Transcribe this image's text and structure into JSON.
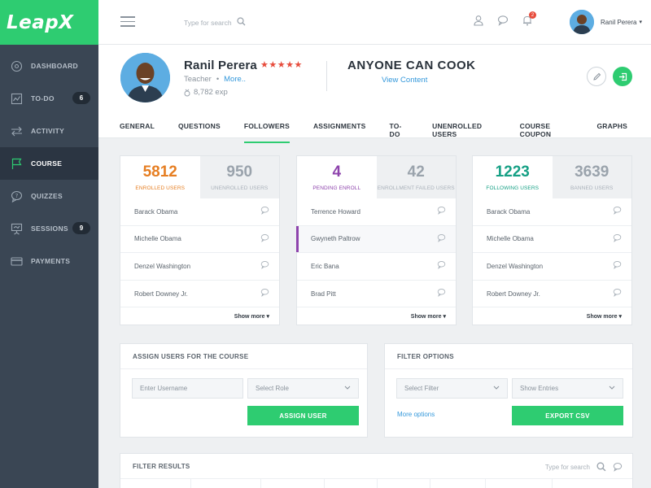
{
  "app": {
    "logo": "LeapX",
    "brand_color": "#2ecc71"
  },
  "sidebar": {
    "items": [
      {
        "label": "DASHBOARD",
        "icon": "dashboard-icon",
        "badge": null,
        "active": false
      },
      {
        "label": "TO-DO",
        "icon": "todo-icon",
        "badge": "6",
        "active": false
      },
      {
        "label": "ACTIVITY",
        "icon": "activity-icon",
        "badge": null,
        "active": false
      },
      {
        "label": "COURSE",
        "icon": "flag-icon",
        "badge": null,
        "active": true
      },
      {
        "label": "QUIZZES",
        "icon": "quiz-icon",
        "badge": null,
        "active": false
      },
      {
        "label": "SESSIONS",
        "icon": "presentation-icon",
        "badge": "9",
        "active": false
      },
      {
        "label": "PAYMENTS",
        "icon": "card-icon",
        "badge": null,
        "active": false
      }
    ]
  },
  "topbar": {
    "search_placeholder": "Type for search",
    "notification_count": "2",
    "user_name": "Ranil Perera",
    "icons": [
      "user-icon",
      "chat-icon",
      "bell-icon"
    ]
  },
  "profile": {
    "name": "Ranil Perera",
    "rating": 5,
    "stars": "★★★★★",
    "role": "Teacher",
    "dot": "•",
    "more": "More..",
    "exp": "8,782 exp",
    "course_title": "ANYONE CAN COOK",
    "view_content": "View Content"
  },
  "tabs": [
    {
      "label": "GENERAL",
      "active": false
    },
    {
      "label": "QUESTIONS",
      "active": false
    },
    {
      "label": "FOLLOWERS",
      "active": true
    },
    {
      "label": "ASSIGNMENTS",
      "active": false
    },
    {
      "label": "TO-DO",
      "active": false
    },
    {
      "label": "UNENROLLED USERS",
      "active": false
    },
    {
      "label": "COURSE COUPON",
      "active": false
    },
    {
      "label": "GRAPHS",
      "active": false
    }
  ],
  "cards": [
    {
      "stats": [
        {
          "value": "5812",
          "label": "ENROLLED USERS",
          "color": "#e67e22",
          "active": true
        },
        {
          "value": "950",
          "label": "UNENROLLED USERS",
          "color": "#9aa3ac",
          "active": false
        }
      ],
      "rows": [
        "Barack Obama",
        "Michelle Obama",
        "Denzel Washington",
        "Robert Downey Jr."
      ],
      "highlight_row": -1,
      "show_more": "Show more"
    },
    {
      "stats": [
        {
          "value": "4",
          "label": "PENDING ENROLL",
          "color": "#8e44ad",
          "active": true
        },
        {
          "value": "42",
          "label": "ENROLLMENT FAILED USERS",
          "color": "#9aa3ac",
          "active": false
        }
      ],
      "rows": [
        "Terrence Howard",
        "Gwyneth Paltrow",
        "Eric Bana",
        "Brad Pitt"
      ],
      "highlight_row": 1,
      "show_more": "Show more"
    },
    {
      "stats": [
        {
          "value": "1223",
          "label": "FOLLOWING USERS",
          "color": "#16a085",
          "active": true
        },
        {
          "value": "3639",
          "label": "BANNED USERS",
          "color": "#9aa3ac",
          "active": false
        }
      ],
      "rows": [
        "Barack Obama",
        "Michelle Obama",
        "Denzel Washington",
        "Robert Downey Jr."
      ],
      "highlight_row": -1,
      "show_more": "Show more"
    }
  ],
  "assign_panel": {
    "title": "ASSIGN USERS FOR THE COURSE",
    "username_placeholder": "Enter Username",
    "role_select": "Select Role",
    "button": "ASSIGN USER"
  },
  "filter_panel": {
    "title": "FILTER OPTIONS",
    "filter_select": "Select Filter",
    "entries_select": "Show Entries",
    "more_options": "More options",
    "button": "EXPORT CSV"
  },
  "results": {
    "title": "FILTER RESULTS",
    "search_placeholder": "Type for search"
  }
}
